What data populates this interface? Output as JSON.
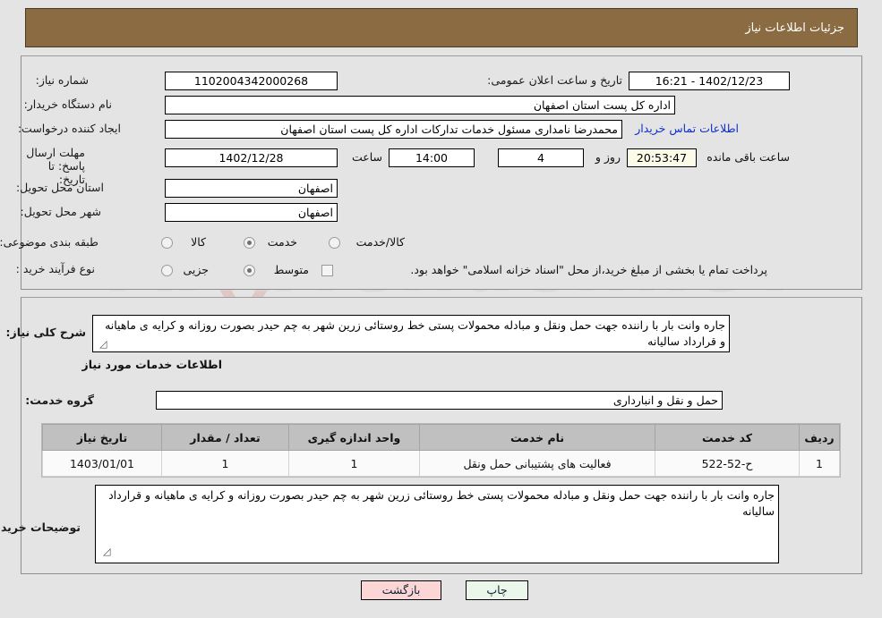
{
  "header": {
    "title": "جزئیات اطلاعات نیاز"
  },
  "top_form": {
    "need_number_label": "شماره نیاز:",
    "need_number_value": "1102004342000268",
    "public_announce_label": "تاریخ و ساعت اعلان عمومی:",
    "public_announce_value": "1402/12/23 - 16:21",
    "buyer_org_label": "نام دستگاه خریدار:",
    "buyer_org_value": "اداره کل پست استان اصفهان",
    "requester_label": "ایجاد کننده درخواست:",
    "requester_value": "محمدرضا نامداری مسئول خدمات تدارکات اداره کل پست استان اصفهان",
    "contact_link": "اطلاعات تماس خریدار",
    "deadline_label": "مهلت ارسال پاسخ: تا تاریخ:",
    "deadline_date": "1402/12/28",
    "hour_label": "ساعت",
    "deadline_time": "14:00",
    "remaining_days": "4",
    "days_and_label": "روز و",
    "remaining_time": "20:53:47",
    "remaining_suffix": "ساعت باقی مانده",
    "province_label": "استان محل تحویل:",
    "province_value": "اصفهان",
    "city_label": "شهر محل تحویل:",
    "city_value": "اصفهان",
    "category_label": "طبقه بندی موضوعی:",
    "category_options": [
      {
        "label": "کالا",
        "selected": false
      },
      {
        "label": "خدمت",
        "selected": true
      },
      {
        "label": "کالا/خدمت",
        "selected": false
      }
    ],
    "process_label": "نوع فرآیند خرید :",
    "process_options": [
      {
        "label": "جزیی",
        "selected": false
      },
      {
        "label": "متوسط",
        "selected": true
      }
    ],
    "treasury_checkbox_checked": false,
    "treasury_note": "پرداخت تمام یا بخشی از مبلغ خرید،از محل \"اسناد خزانه اسلامی\" خواهد بود."
  },
  "bottom": {
    "summary_label": "شرح کلی نیاز:",
    "summary_value": "جاره وانت بار با راننده جهت حمل ونقل و مبادله محمولات  پستی خط روستائی زرین شهر به چم حیدر بصورت روزانه و کرایه ی ماهیانه و قرارداد سالیانه",
    "services_heading": "اطلاعات خدمات مورد نیاز",
    "service_group_label": "گروه خدمت:",
    "service_group_value": "حمل و نقل و انبارداری",
    "notes_label": "توضیحات خریدار:",
    "notes_value": "جاره وانت بار با راننده جهت حمل ونقل و مبادله محمولات  پستی خط روستائی زرین شهر به چم حیدر بصورت روزانه و کرایه ی ماهیانه و قرارداد سالیانه"
  },
  "table": {
    "columns": [
      "ردیف",
      "کد خدمت",
      "نام خدمت",
      "واحد اندازه گیری",
      "تعداد / مقدار",
      "تاریخ نیاز"
    ],
    "rows": [
      [
        "1",
        "ح-52-522",
        "فعالیت های پشتیبانی حمل ونقل",
        "1",
        "1",
        "1403/01/01"
      ]
    ]
  },
  "buttons": {
    "print": "چاپ",
    "back": "بازگشت"
  },
  "watermark": {
    "text": "AriaTender.net"
  },
  "colors": {
    "header_bg": "#8b6c42",
    "panel_bg": "#e4e4e4",
    "link": "#0f2fc8",
    "timer_bg": "#fbfbe8",
    "print_bg": "#eaf7ea",
    "back_bg": "#fbd6d6",
    "th_bg": "#c0c0c0"
  }
}
